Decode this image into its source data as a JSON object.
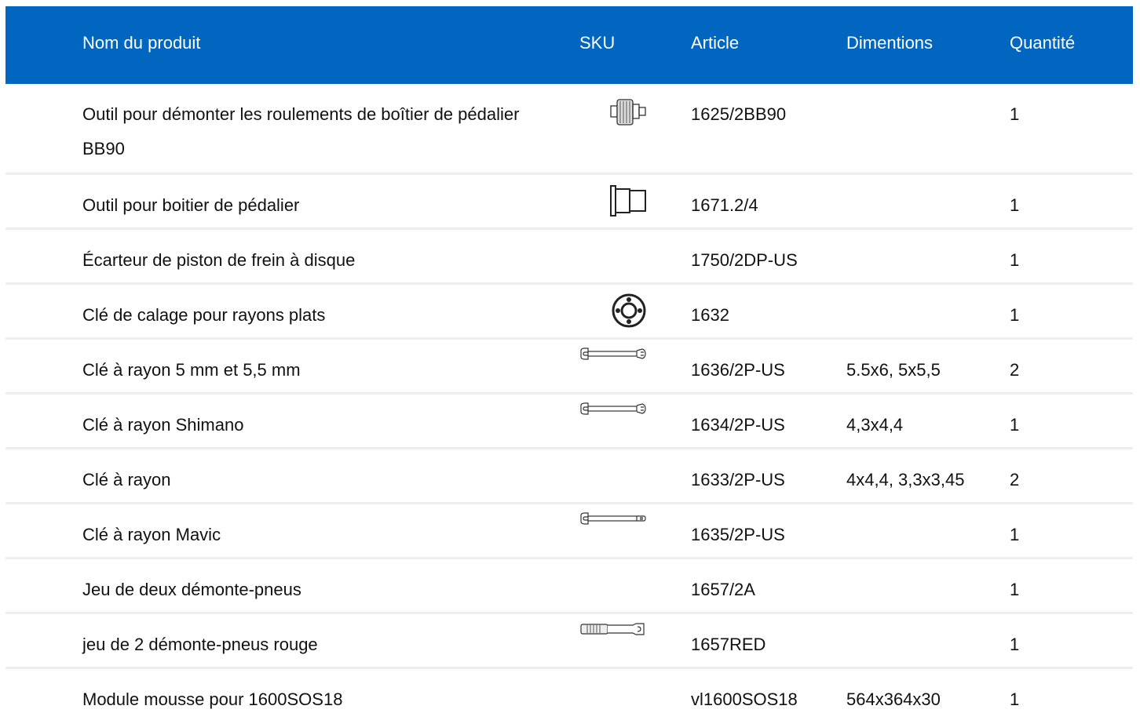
{
  "table": {
    "headers": {
      "name": "Nom du produit",
      "sku": "SKU",
      "article": "Article",
      "dimensions": "Dimentions",
      "quantity": "Quantité"
    },
    "rows": [
      {
        "name": "Outil pour démonter les roulements de boîtier de pédalier BB90",
        "sku_icon": "bearing-tool-icon",
        "article": "1625/2BB90",
        "dimensions": "",
        "quantity": "1"
      },
      {
        "name": "Outil pour boitier de pédalier",
        "sku_icon": "bottom-bracket-tool-icon",
        "article": "1671.2/4",
        "dimensions": "",
        "quantity": "1"
      },
      {
        "name": "Écarteur de piston de frein à disque",
        "sku_icon": "",
        "article": "1750/2DP-US",
        "dimensions": "",
        "quantity": "1"
      },
      {
        "name": "Clé de calage pour rayons plats",
        "sku_icon": "ring-tool-icon",
        "article": "1632",
        "dimensions": "",
        "quantity": "1"
      },
      {
        "name": "Clé à rayon 5 mm et 5,5 mm",
        "sku_icon": "spoke-wrench-icon",
        "article": "1636/2P-US",
        "dimensions": "5.5x6, 5x5,5",
        "quantity": "2"
      },
      {
        "name": "Clé à rayon Shimano",
        "sku_icon": "spoke-wrench-icon",
        "article": "1634/2P-US",
        "dimensions": "4,3x4,4",
        "quantity": "1"
      },
      {
        "name": "Clé à rayon",
        "sku_icon": "",
        "article": "1633/2P-US",
        "dimensions": "4x4,4, 3,3x3,45",
        "quantity": "2"
      },
      {
        "name": "Clé à rayon Mavic",
        "sku_icon": "spoke-wrench-icon",
        "article": "1635/2P-US",
        "dimensions": "",
        "quantity": "1"
      },
      {
        "name": "Jeu de deux démonte-pneus",
        "sku_icon": "",
        "article": "1657/2A",
        "dimensions": "",
        "quantity": "1"
      },
      {
        "name": "jeu de 2 démonte-pneus rouge",
        "sku_icon": "tire-lever-icon",
        "article": "1657RED",
        "dimensions": "",
        "quantity": "1"
      },
      {
        "name": "Module mousse pour 1600SOS18",
        "sku_icon": "",
        "article": "vl1600SOS18",
        "dimensions": "564x364x30",
        "quantity": "1"
      }
    ]
  },
  "colors": {
    "header_bg": "#0066c0",
    "header_text": "#ffffff",
    "row_divider": "#eeeeee"
  }
}
